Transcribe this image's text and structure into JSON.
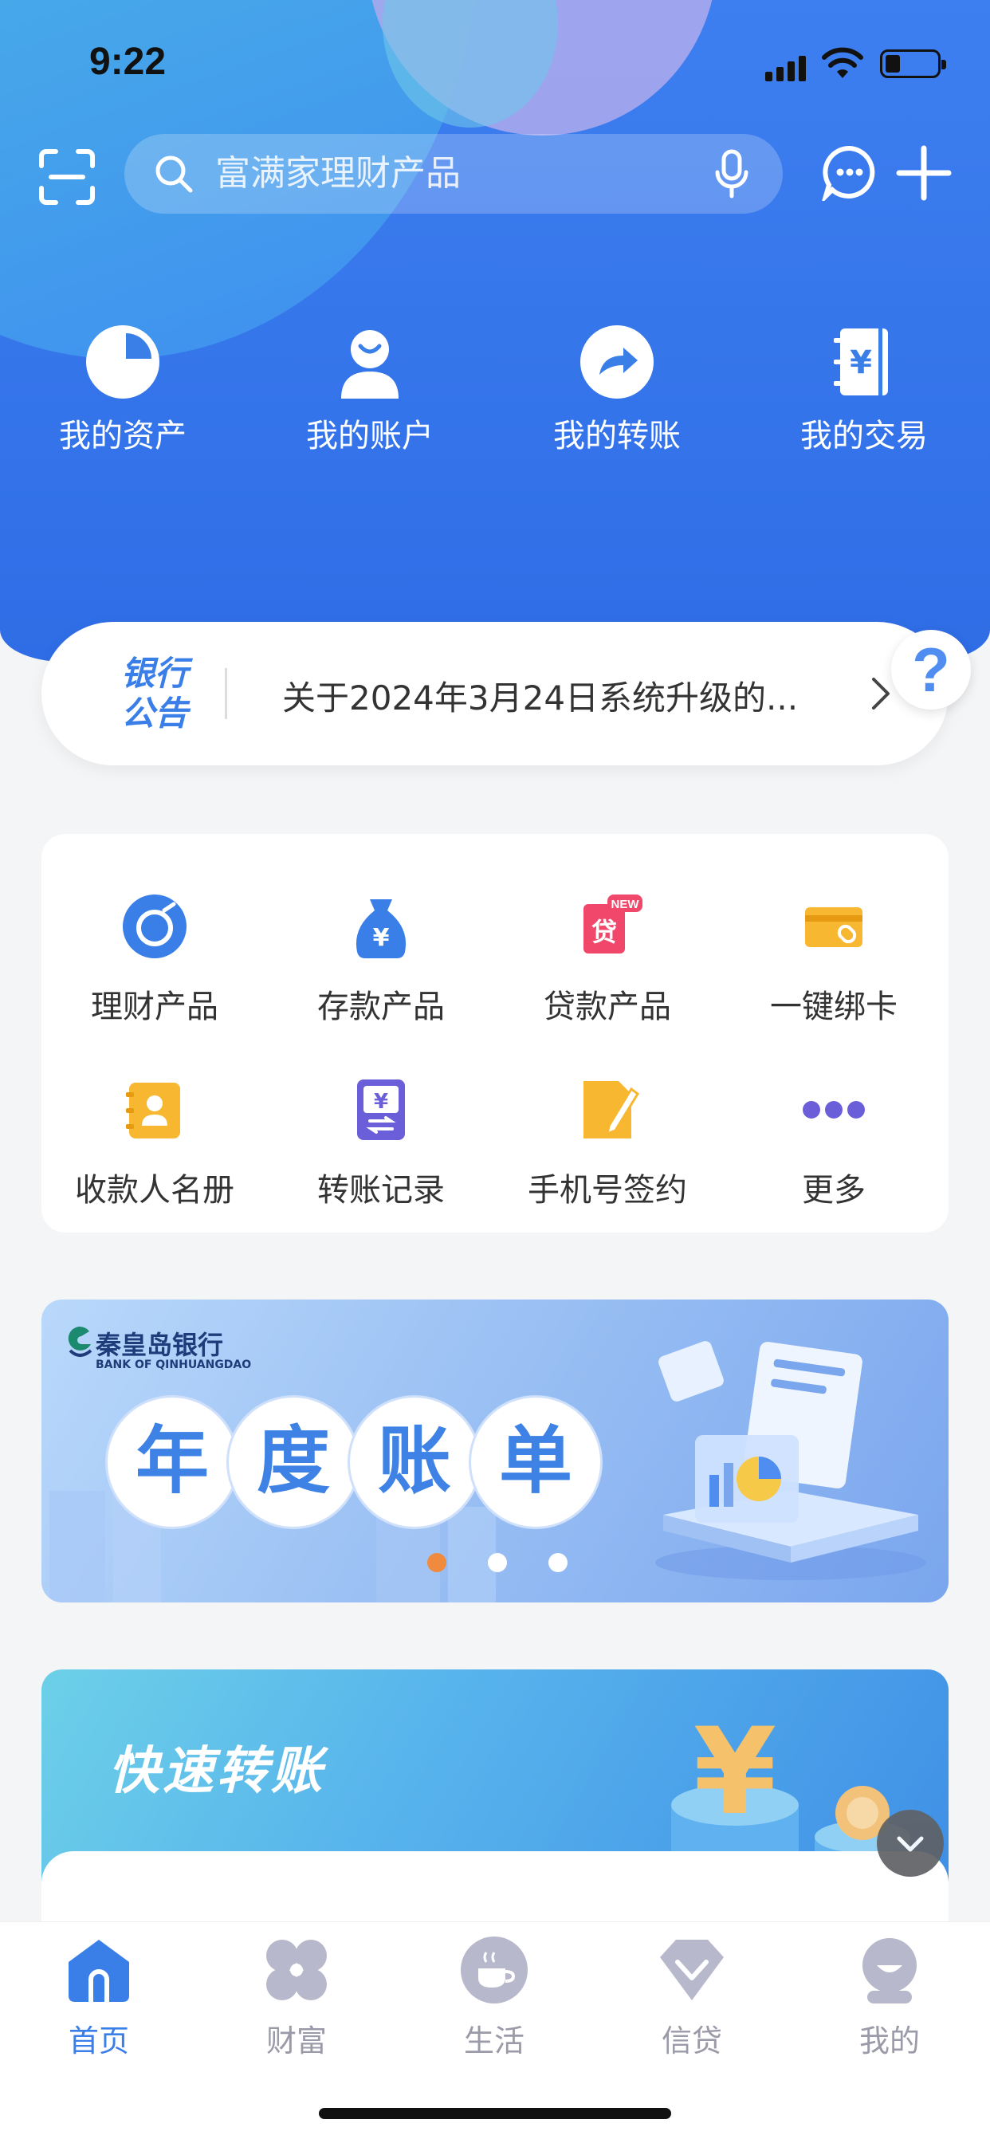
{
  "status_bar": {
    "time": "9:22"
  },
  "search": {
    "placeholder": "富满家理财产品"
  },
  "quick_entries": [
    {
      "label": "我的资产",
      "icon": "pie-chart-icon"
    },
    {
      "label": "我的账户",
      "icon": "user-icon"
    },
    {
      "label": "我的转账",
      "icon": "transfer-arrow-icon"
    },
    {
      "label": "我的交易",
      "icon": "yuan-notebook-icon"
    }
  ],
  "notice": {
    "tag_line1": "银行",
    "tag_line2": "公告",
    "text": "关于2024年3月24日系统升级的..."
  },
  "help": {
    "label": "?"
  },
  "functions": [
    {
      "label": "理财产品",
      "icon": "wealth-product-icon"
    },
    {
      "label": "存款产品",
      "icon": "money-bag-icon"
    },
    {
      "label": "贷款产品",
      "icon": "loan-icon",
      "badge": "NEW",
      "icon_text": "贷"
    },
    {
      "label": "一键绑卡",
      "icon": "bind-card-icon"
    },
    {
      "label": "收款人名册",
      "icon": "payee-book-icon"
    },
    {
      "label": "转账记录",
      "icon": "transfer-record-icon"
    },
    {
      "label": "手机号签约",
      "icon": "phone-sign-icon"
    },
    {
      "label": "更多",
      "icon": "more-dots-icon"
    }
  ],
  "banner": {
    "bank_name": "秦皇岛银行",
    "bank_name_en": "BANK OF QINHUANGDAO",
    "chars": [
      "年",
      "度",
      "账",
      "单"
    ],
    "page_count": 3,
    "active_page": 1
  },
  "transfer_card": {
    "title": "快速转账"
  },
  "tabs": [
    {
      "label": "首页",
      "icon": "home-icon",
      "active": true
    },
    {
      "label": "财富",
      "icon": "wealth-clover-icon",
      "active": false
    },
    {
      "label": "生活",
      "icon": "coffee-icon",
      "active": false
    },
    {
      "label": "信贷",
      "icon": "diamond-icon",
      "active": false
    },
    {
      "label": "我的",
      "icon": "profile-icon",
      "active": false
    }
  ],
  "colors": {
    "primary": "#3a7ee8",
    "accent_orange": "#f08a3c",
    "tab_inactive": "#9a9aa8"
  }
}
